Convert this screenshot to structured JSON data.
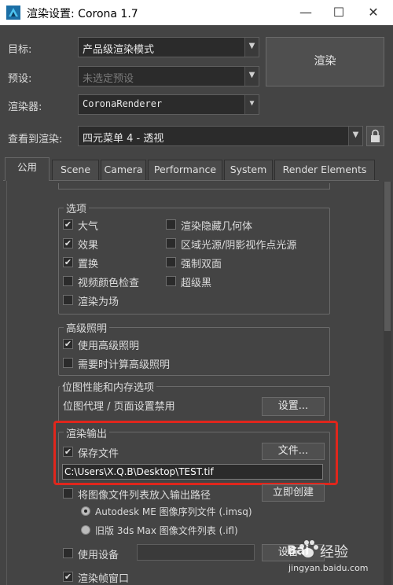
{
  "window": {
    "title": "渲染设置: Corona 1.7",
    "minimize": "—",
    "maximize": "☐",
    "close": "✕"
  },
  "form": {
    "target_label": "目标:",
    "target_value": "产品级渲染模式",
    "preset_label": "预设:",
    "preset_value": "未选定预设",
    "renderer_label": "渲染器:",
    "renderer_value": "CoronaRenderer",
    "view_label": "查看到渲染:",
    "view_value": "四元菜单 4 - 透视",
    "render_button": "渲染"
  },
  "tabs": [
    "公用",
    "Scene",
    "Camera",
    "Performance",
    "System",
    "Render Elements"
  ],
  "options": {
    "title": "选项",
    "items": [
      {
        "label": "大气",
        "checked": true
      },
      {
        "label": "渲染隐藏几何体",
        "checked": false
      },
      {
        "label": "效果",
        "checked": true
      },
      {
        "label": "区域光源/阴影视作点光源",
        "checked": false
      },
      {
        "label": "置换",
        "checked": true
      },
      {
        "label": "强制双面",
        "checked": false
      },
      {
        "label": "视频颜色检查",
        "checked": false
      },
      {
        "label": "超级黑",
        "checked": false
      },
      {
        "label": "渲染为场",
        "checked": false
      }
    ]
  },
  "advanced_lighting": {
    "title": "高级照明",
    "use": "使用高级照明",
    "compute": "需要时计算高级照明"
  },
  "bitmap": {
    "title": "位图性能和内存选项",
    "text": "位图代理 / 页面设置禁用",
    "setup_button": "设置..."
  },
  "render_output": {
    "title": "渲染输出",
    "save_file": "保存文件",
    "files_button": "文件...",
    "path": "C:\\Users\\X.Q.B\\Desktop\\TEST.tif",
    "put_list": "将图像文件列表放入输出路径",
    "create_button": "立即创建",
    "autodesk": "Autodesk ME 图像序列文件 (.imsq)",
    "legacy": "旧版 3ds Max 图像文件列表 (.ifl)",
    "use_device": "使用设备",
    "device_button": "设备...",
    "frame_window": "渲染帧窗口"
  },
  "watermark": {
    "brand": "Bai",
    "brand_cn": "经验",
    "url": "jingyan.baidu.com"
  },
  "colors": {
    "highlight": "#e0261c",
    "background": "#444444",
    "accent_icon": "#2a9bd8"
  }
}
